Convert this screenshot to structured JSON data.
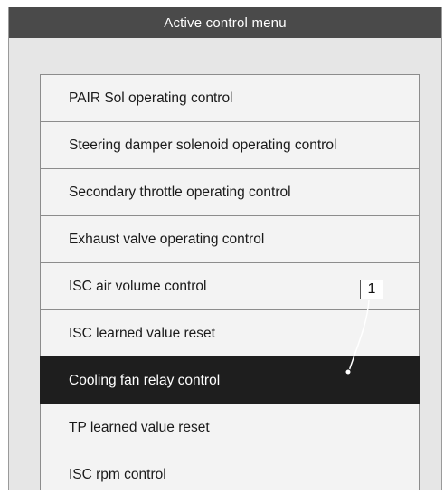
{
  "window": {
    "title": "Active control menu"
  },
  "menu": {
    "items": [
      {
        "label": "PAIR Sol operating control"
      },
      {
        "label": "Steering damper solenoid operating control"
      },
      {
        "label": "Secondary throttle operating control"
      },
      {
        "label": "Exhaust valve operating control"
      },
      {
        "label": "ISC air volume control"
      },
      {
        "label": "ISC learned value reset"
      },
      {
        "label": "Cooling fan relay control",
        "selected": true
      },
      {
        "label": "TP learned value reset"
      },
      {
        "label": "ISC rpm control"
      }
    ]
  },
  "callout": {
    "number": "1"
  },
  "colors": {
    "title_bar": "#4a4a4a",
    "panel_bg": "#e6e6e6",
    "item_bg": "#f3f3f3",
    "selected_bg": "#1e1e1e",
    "selected_text": "#ffffff"
  }
}
